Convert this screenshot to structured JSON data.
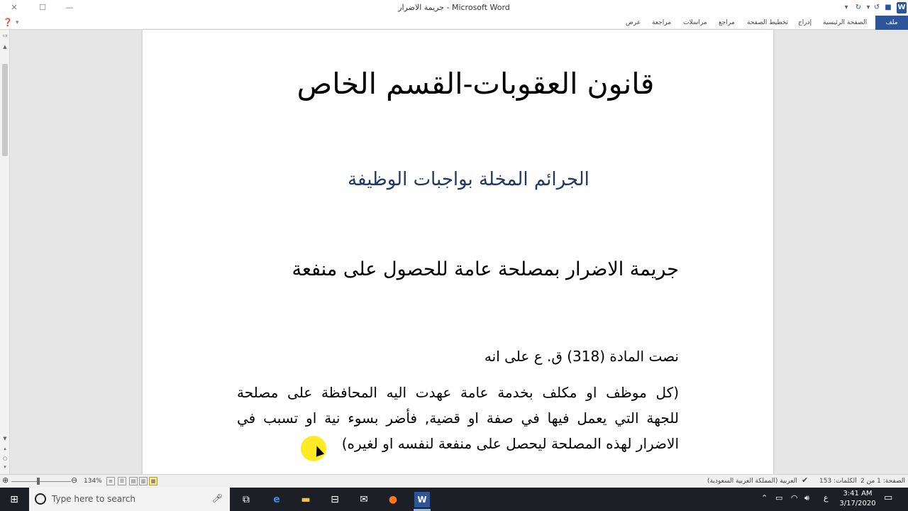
{
  "window": {
    "title": "جريمة الاضرار - Microsoft Word"
  },
  "ribbon": {
    "tabs": [
      "ملف",
      "الصفحة الرئيسية",
      "إدراج",
      "تخطيط الصفحة",
      "مراجع",
      "مراسلات",
      "مراجعة",
      "عرض"
    ]
  },
  "document": {
    "heading1": "قانون العقوبات-القسم الخاص",
    "heading2": "الجرائم المخلة بواجبات الوظيفة",
    "heading3": "جريمة الاضرار بمصلحة عامة للحصول على منفعة",
    "intro": "نصت المادة (318) ق. ع على انه",
    "paragraph_lines": [
      "(كل موظف او مكلف بخدمة عامة عهدت اليه المحافظة على مصلحة",
      "للجهة التي يعمل فيها في صفة او قضية, فأضر بسوء نية او تسبب في",
      "الاضرار لهذه المصلحة ليحصل على منفعة لنفسه او لغيره)"
    ]
  },
  "statusbar": {
    "page": "الصفحة: 1 من 2",
    "words": "الكلمات: 153",
    "language": "العربية (المملكة العربية السعودية)",
    "zoom": "134%"
  },
  "taskbar": {
    "search_placeholder": "Type here to search",
    "time": "3:41 AM",
    "date": "3/17/2020",
    "input_lang": "ع"
  },
  "colors": {
    "accent": "#2b579a",
    "heading2": "#1f3864",
    "highlight": "#ffe600"
  }
}
